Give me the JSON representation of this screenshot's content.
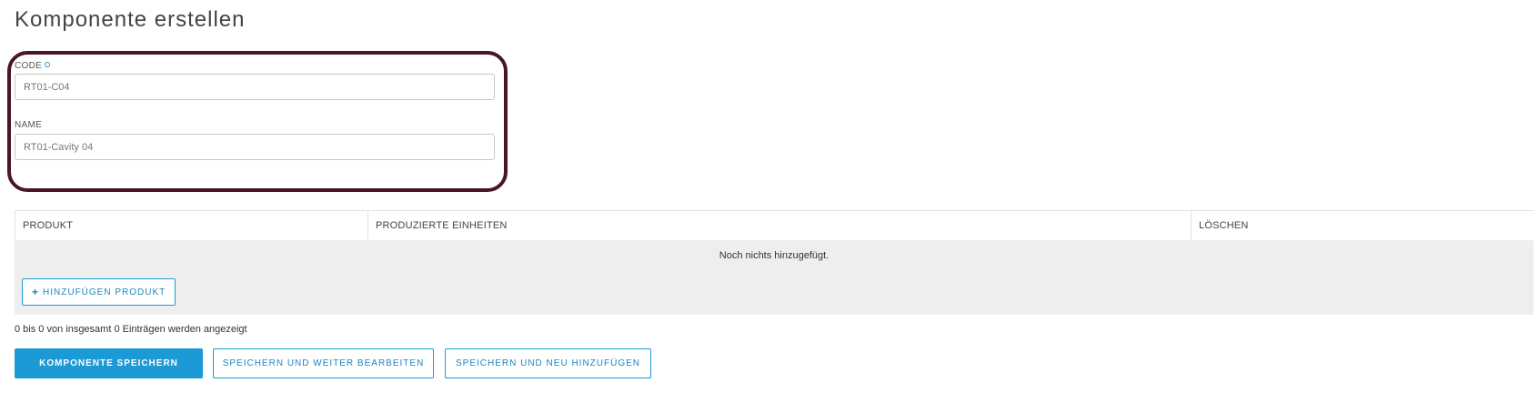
{
  "page": {
    "title": "Komponente erstellen"
  },
  "form": {
    "code": {
      "label": "CODE",
      "value": "RT01-C04",
      "required": true
    },
    "name": {
      "label": "NAME",
      "value": "RT01-Cavity 04"
    }
  },
  "table": {
    "columns": [
      "PRODUKT",
      "PRODUZIERTE EINHEITEN",
      "LÖSCHEN"
    ],
    "empty_message": "Noch nichts hinzugefügt.",
    "add_button_label": "HINZUFÜGEN PRODUKT"
  },
  "count_info": "0 bis 0 von insgesamt 0 Einträgen werden angezeigt",
  "actions": {
    "save_label": "KOMPONENTE SPEICHERN",
    "save_continue_label": "SPEICHERN UND WEITER BEARBEITEN",
    "save_new_label": "SPEICHERN UND NEU HINZUFÜGEN"
  },
  "colors": {
    "accent": "#1b9ad6",
    "highlight_border": "#4a1528",
    "table_body_bg": "#eeeeee"
  }
}
